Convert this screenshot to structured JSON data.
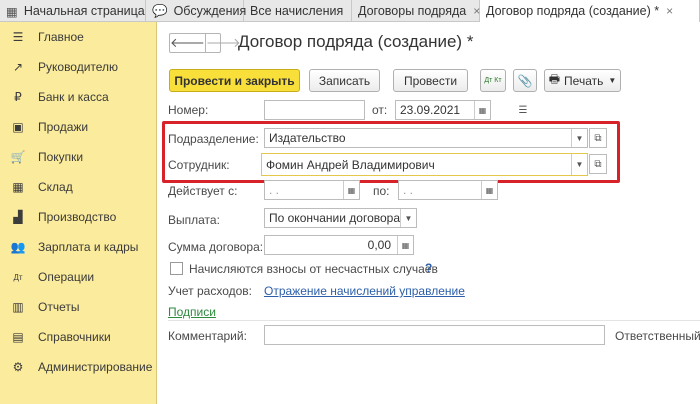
{
  "tabs": [
    {
      "label": "Начальная страница",
      "icon": "grid-icon",
      "active": false
    },
    {
      "label": "Обсуждения",
      "icon": "chat-icon",
      "active": false
    },
    {
      "label": "Все начисления",
      "active": false
    },
    {
      "label": "Договоры подряда",
      "close": "×",
      "active": false
    },
    {
      "label": "Договор подряда (создание) *",
      "close": "×",
      "active": true
    }
  ],
  "sidebar": {
    "items": [
      {
        "label": "Главное",
        "icon": "menu-icon",
        "glyph": "☰"
      },
      {
        "label": "Руководителю",
        "icon": "trend-icon",
        "glyph": "↗"
      },
      {
        "label": "Банк и касса",
        "icon": "coin-icon",
        "glyph": "₽"
      },
      {
        "label": "Продажи",
        "icon": "bag-icon",
        "glyph": "▣"
      },
      {
        "label": "Покупки",
        "icon": "cart-icon",
        "glyph": "🛒"
      },
      {
        "label": "Склад",
        "icon": "warehouse-icon",
        "glyph": "▦"
      },
      {
        "label": "Производство",
        "icon": "factory-icon",
        "glyph": "▟"
      },
      {
        "label": "Зарплата и кадры",
        "icon": "people-icon",
        "glyph": "👥"
      },
      {
        "label": "Операции",
        "icon": "dt-kt-icon",
        "glyph": "Дт"
      },
      {
        "label": "Отчеты",
        "icon": "report-icon",
        "glyph": "▥"
      },
      {
        "label": "Справочники",
        "icon": "book-icon",
        "glyph": "▤"
      },
      {
        "label": "Администрирование",
        "icon": "gear-icon",
        "glyph": "⚙"
      }
    ]
  },
  "form": {
    "title": "Договор подряда (создание) *",
    "toolbar": {
      "post_close": "Провести и закрыть",
      "save": "Записать",
      "post": "Провести",
      "dtkt": "Дт Кт",
      "print": "Печать"
    },
    "number_label": "Номер:",
    "number_value": "",
    "from_label": "от:",
    "date_value": "23.09.2021",
    "division_label": "Подразделение:",
    "division_value": "Издательство",
    "employee_label": "Сотрудник:",
    "employee_value": "Фомин Андрей Владимирович",
    "valid_from_label": "Действует с:",
    "valid_from_value": ". .",
    "valid_to_label": "по:",
    "valid_to_value": ". .",
    "payment_label": "Выплата:",
    "payment_value": "По окончании договора",
    "amount_label": "Сумма договора:",
    "amount_value": "0,00",
    "accident_label": "Начисляются взносы от несчастных случаев",
    "help": "?",
    "expense_label": "Учет расходов:",
    "expense_link": "Отражение начислений управление",
    "signatures_link": "Подписи",
    "comment_label": "Комментарий:",
    "comment_value": "",
    "responsible_label": "Ответственный:"
  },
  "colors": {
    "sidebar_bg": "#fbeb9c",
    "primary_button": "#f9df3a",
    "highlight_frame": "#d7222a",
    "link": "#2d5fa8"
  }
}
